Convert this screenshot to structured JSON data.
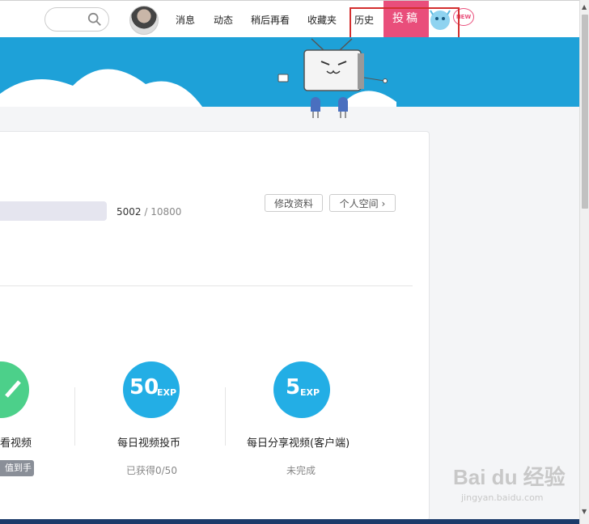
{
  "header": {
    "nav": [
      "消息",
      "动态",
      "稍后再看",
      "收藏夹",
      "历史"
    ],
    "post_button": "投稿",
    "new_badge": "NEW"
  },
  "profile": {
    "exp_current": "5002",
    "exp_separator": "/",
    "exp_max": "10800",
    "exp_progress": 0.46,
    "edit_button": "修改资料",
    "space_button": "个人空间"
  },
  "tasks": [
    {
      "title": "看视频",
      "tag": "值到手",
      "color": "#4cd08a"
    },
    {
      "title": "每日视频投币",
      "points": "50",
      "unit": "EXP",
      "status": "已获得0/50",
      "color": "#23aee5"
    },
    {
      "title": "每日分享视频(客户端)",
      "points": "5",
      "unit": "EXP",
      "status": "未完成",
      "color": "#23aee5"
    }
  ],
  "watermark": {
    "logo": "Bai du 经验",
    "sub": "jingyan.baidu.com"
  }
}
